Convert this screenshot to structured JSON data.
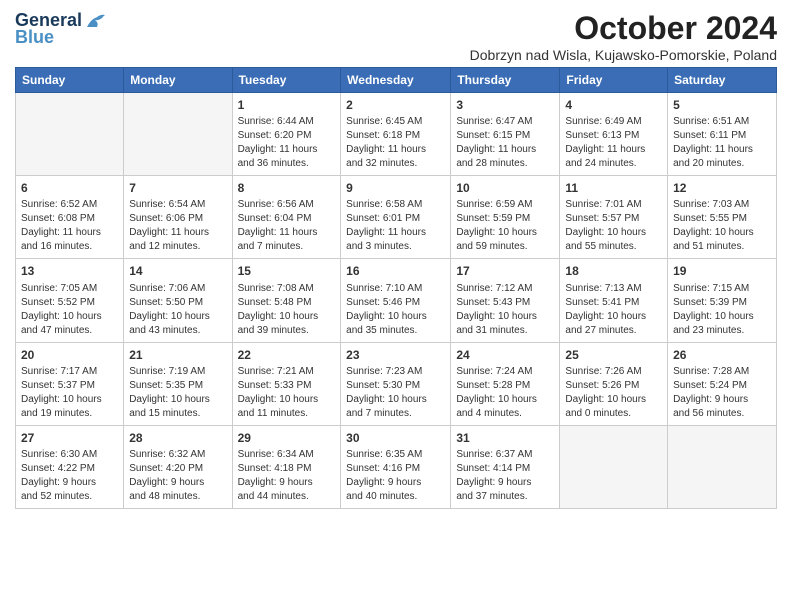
{
  "header": {
    "logo_line1": "General",
    "logo_line2": "Blue",
    "main_title": "October 2024",
    "subtitle": "Dobrzyn nad Wisla, Kujawsko-Pomorskie, Poland"
  },
  "weekdays": [
    "Sunday",
    "Monday",
    "Tuesday",
    "Wednesday",
    "Thursday",
    "Friday",
    "Saturday"
  ],
  "weeks": [
    [
      {
        "day": "",
        "info": ""
      },
      {
        "day": "",
        "info": ""
      },
      {
        "day": "1",
        "info": "Sunrise: 6:44 AM\nSunset: 6:20 PM\nDaylight: 11 hours\nand 36 minutes."
      },
      {
        "day": "2",
        "info": "Sunrise: 6:45 AM\nSunset: 6:18 PM\nDaylight: 11 hours\nand 32 minutes."
      },
      {
        "day": "3",
        "info": "Sunrise: 6:47 AM\nSunset: 6:15 PM\nDaylight: 11 hours\nand 28 minutes."
      },
      {
        "day": "4",
        "info": "Sunrise: 6:49 AM\nSunset: 6:13 PM\nDaylight: 11 hours\nand 24 minutes."
      },
      {
        "day": "5",
        "info": "Sunrise: 6:51 AM\nSunset: 6:11 PM\nDaylight: 11 hours\nand 20 minutes."
      }
    ],
    [
      {
        "day": "6",
        "info": "Sunrise: 6:52 AM\nSunset: 6:08 PM\nDaylight: 11 hours\nand 16 minutes."
      },
      {
        "day": "7",
        "info": "Sunrise: 6:54 AM\nSunset: 6:06 PM\nDaylight: 11 hours\nand 12 minutes."
      },
      {
        "day": "8",
        "info": "Sunrise: 6:56 AM\nSunset: 6:04 PM\nDaylight: 11 hours\nand 7 minutes."
      },
      {
        "day": "9",
        "info": "Sunrise: 6:58 AM\nSunset: 6:01 PM\nDaylight: 11 hours\nand 3 minutes."
      },
      {
        "day": "10",
        "info": "Sunrise: 6:59 AM\nSunset: 5:59 PM\nDaylight: 10 hours\nand 59 minutes."
      },
      {
        "day": "11",
        "info": "Sunrise: 7:01 AM\nSunset: 5:57 PM\nDaylight: 10 hours\nand 55 minutes."
      },
      {
        "day": "12",
        "info": "Sunrise: 7:03 AM\nSunset: 5:55 PM\nDaylight: 10 hours\nand 51 minutes."
      }
    ],
    [
      {
        "day": "13",
        "info": "Sunrise: 7:05 AM\nSunset: 5:52 PM\nDaylight: 10 hours\nand 47 minutes."
      },
      {
        "day": "14",
        "info": "Sunrise: 7:06 AM\nSunset: 5:50 PM\nDaylight: 10 hours\nand 43 minutes."
      },
      {
        "day": "15",
        "info": "Sunrise: 7:08 AM\nSunset: 5:48 PM\nDaylight: 10 hours\nand 39 minutes."
      },
      {
        "day": "16",
        "info": "Sunrise: 7:10 AM\nSunset: 5:46 PM\nDaylight: 10 hours\nand 35 minutes."
      },
      {
        "day": "17",
        "info": "Sunrise: 7:12 AM\nSunset: 5:43 PM\nDaylight: 10 hours\nand 31 minutes."
      },
      {
        "day": "18",
        "info": "Sunrise: 7:13 AM\nSunset: 5:41 PM\nDaylight: 10 hours\nand 27 minutes."
      },
      {
        "day": "19",
        "info": "Sunrise: 7:15 AM\nSunset: 5:39 PM\nDaylight: 10 hours\nand 23 minutes."
      }
    ],
    [
      {
        "day": "20",
        "info": "Sunrise: 7:17 AM\nSunset: 5:37 PM\nDaylight: 10 hours\nand 19 minutes."
      },
      {
        "day": "21",
        "info": "Sunrise: 7:19 AM\nSunset: 5:35 PM\nDaylight: 10 hours\nand 15 minutes."
      },
      {
        "day": "22",
        "info": "Sunrise: 7:21 AM\nSunset: 5:33 PM\nDaylight: 10 hours\nand 11 minutes."
      },
      {
        "day": "23",
        "info": "Sunrise: 7:23 AM\nSunset: 5:30 PM\nDaylight: 10 hours\nand 7 minutes."
      },
      {
        "day": "24",
        "info": "Sunrise: 7:24 AM\nSunset: 5:28 PM\nDaylight: 10 hours\nand 4 minutes."
      },
      {
        "day": "25",
        "info": "Sunrise: 7:26 AM\nSunset: 5:26 PM\nDaylight: 10 hours\nand 0 minutes."
      },
      {
        "day": "26",
        "info": "Sunrise: 7:28 AM\nSunset: 5:24 PM\nDaylight: 9 hours\nand 56 minutes."
      }
    ],
    [
      {
        "day": "27",
        "info": "Sunrise: 6:30 AM\nSunset: 4:22 PM\nDaylight: 9 hours\nand 52 minutes."
      },
      {
        "day": "28",
        "info": "Sunrise: 6:32 AM\nSunset: 4:20 PM\nDaylight: 9 hours\nand 48 minutes."
      },
      {
        "day": "29",
        "info": "Sunrise: 6:34 AM\nSunset: 4:18 PM\nDaylight: 9 hours\nand 44 minutes."
      },
      {
        "day": "30",
        "info": "Sunrise: 6:35 AM\nSunset: 4:16 PM\nDaylight: 9 hours\nand 40 minutes."
      },
      {
        "day": "31",
        "info": "Sunrise: 6:37 AM\nSunset: 4:14 PM\nDaylight: 9 hours\nand 37 minutes."
      },
      {
        "day": "",
        "info": ""
      },
      {
        "day": "",
        "info": ""
      }
    ]
  ]
}
